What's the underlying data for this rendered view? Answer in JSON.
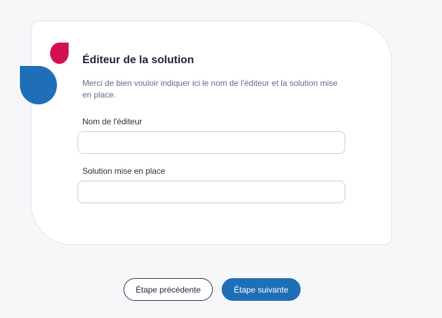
{
  "form": {
    "title": "Éditeur de la solution",
    "description": "Merci de bien vouloir indiquer ici le nom de l'éditeur et la solution mise en place.",
    "fields": [
      {
        "label": "Nom de l'éditeur",
        "value": "",
        "placeholder": ""
      },
      {
        "label": "Solution mise en place",
        "value": "",
        "placeholder": ""
      }
    ]
  },
  "navigation": {
    "previous_label": "Étape précédente",
    "next_label": "Étape suivante"
  },
  "colors": {
    "brand_blue": "#1f6fb8",
    "brand_red": "#d3104f",
    "page_background": "#f6f7f9"
  },
  "icons": {
    "decoration": [
      "red-drop-icon",
      "blue-drop-icon"
    ]
  }
}
